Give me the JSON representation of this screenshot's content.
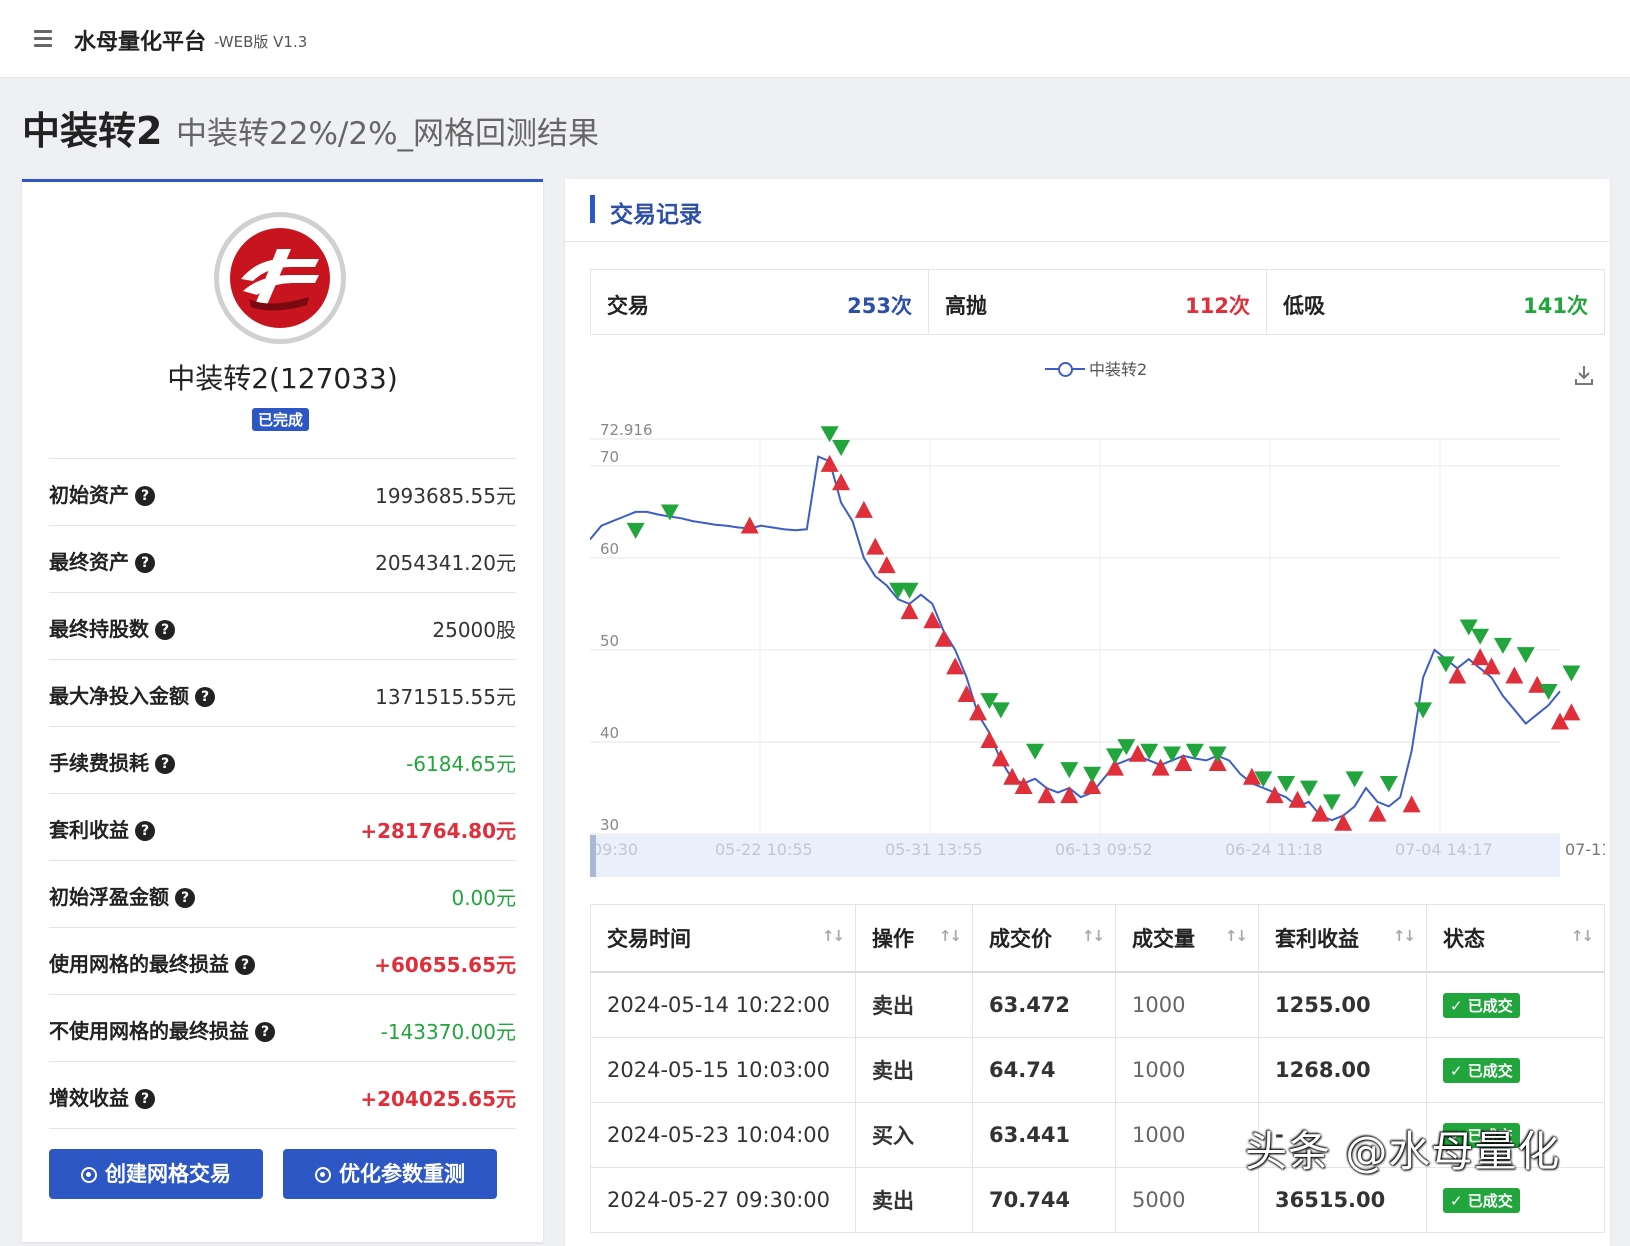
{
  "app": {
    "title": "水母量化平台",
    "subtitle": "-WEB版 V1.3"
  },
  "page": {
    "title": "中装转2",
    "subtitle": "中装转22%/2%_网格回测结果"
  },
  "summary_card": {
    "stock_name": "中装转2(127033)",
    "status_badge": "已完成",
    "stats": [
      {
        "label": "初始资产",
        "value": "1993685.55元",
        "tone": "normal"
      },
      {
        "label": "最终资产",
        "value": "2054341.20元",
        "tone": "normal"
      },
      {
        "label": "最终持股数",
        "value": "25000股",
        "tone": "normal"
      },
      {
        "label": "最大净投入金额",
        "value": "1371515.55元",
        "tone": "normal"
      },
      {
        "label": "手续费损耗",
        "value": "-6184.65元",
        "tone": "green"
      },
      {
        "label": "套利收益",
        "value": "+281764.80元",
        "tone": "red"
      },
      {
        "label": "初始浮盈金额",
        "value": "0.00元",
        "tone": "green"
      },
      {
        "label": "使用网格的最终损益",
        "value": "+60655.65元",
        "tone": "red"
      },
      {
        "label": "不使用网格的最终损益",
        "value": "-143370.00元",
        "tone": "green"
      },
      {
        "label": "增效收益",
        "value": "+204025.65元",
        "tone": "red"
      }
    ],
    "buttons": {
      "create": "创建网格交易",
      "optimize": "优化参数重测"
    }
  },
  "trade_panel": {
    "title": "交易记录",
    "summary": [
      {
        "label": "交易",
        "value": "253次",
        "color": "#2d4fa8"
      },
      {
        "label": "高抛",
        "value": "112次",
        "color": "#de2f3a"
      },
      {
        "label": "低吸",
        "value": "141次",
        "color": "#22a53c"
      }
    ],
    "table": {
      "headers": [
        "交易时间",
        "操作",
        "成交价",
        "成交量",
        "套利收益",
        "状态"
      ],
      "rows": [
        {
          "time": "2024-05-14 10:22:00",
          "op": "卖出",
          "op_type": "sell",
          "price": "63.472",
          "qty": "1000",
          "profit": "1255.00",
          "status": "已成交"
        },
        {
          "time": "2024-05-15 10:03:00",
          "op": "卖出",
          "op_type": "sell",
          "price": "64.74",
          "qty": "1000",
          "profit": "1268.00",
          "status": "已成交"
        },
        {
          "time": "2024-05-23 10:04:00",
          "op": "买入",
          "op_type": "buy",
          "price": "63.441",
          "qty": "1000",
          "profit": "-",
          "status": "已成交"
        },
        {
          "time": "2024-05-27 09:30:00",
          "op": "卖出",
          "op_type": "sell",
          "price": "70.744",
          "qty": "5000",
          "profit": "36515.00",
          "status": "已成交"
        }
      ]
    }
  },
  "chart_data": {
    "type": "line",
    "legend": [
      "中装转2"
    ],
    "series": [
      {
        "name": "中装转2",
        "color": "#3d5ec8",
        "values": [
          62,
          63.5,
          64,
          64.5,
          65,
          65,
          64.7,
          64.5,
          64.3,
          64,
          63.8,
          63.6,
          63.5,
          63.3,
          63.2,
          63.5,
          63.3,
          63.1,
          63,
          63.1,
          71,
          70.5,
          66,
          64,
          60,
          58,
          57,
          55.5,
          55,
          56,
          55,
          52,
          50,
          47,
          43,
          41,
          38,
          36,
          35.5,
          36,
          35,
          34.5,
          35,
          34,
          34.5,
          36,
          37.5,
          38,
          38.5,
          38,
          37.5,
          38,
          38.5,
          38.2,
          38,
          38.5,
          38,
          36.5,
          35.5,
          35,
          34.5,
          34,
          33,
          33.5,
          32,
          31.5,
          32,
          33,
          35,
          33.5,
          33,
          34,
          39,
          47,
          50,
          49,
          48,
          49,
          48,
          47,
          45,
          43.5,
          42,
          43,
          44,
          45.5
        ]
      }
    ],
    "y_ticks": [
      "30",
      "40",
      "50",
      "60",
      "70"
    ],
    "y_max_label": "72.916",
    "ylim": [
      30,
      72.916
    ],
    "x_ticks": [
      "09:30",
      "05-22 10:55",
      "05-31 13:55",
      "06-13 09:52",
      "06-24 11:18",
      "07-04 14:17",
      "07-11"
    ],
    "markers": {
      "sell_color": "#22a53c",
      "buy_color": "#de2f3a"
    },
    "sell_points": [
      [
        4,
        62.5
      ],
      [
        7,
        64.5
      ],
      [
        21,
        73
      ],
      [
        22,
        71.5
      ],
      [
        27,
        56
      ],
      [
        28,
        56
      ],
      [
        35,
        44
      ],
      [
        36,
        43
      ],
      [
        39,
        38.5
      ],
      [
        42,
        36.5
      ],
      [
        44,
        36
      ],
      [
        46,
        38
      ],
      [
        47,
        39
      ],
      [
        49,
        38.5
      ],
      [
        51,
        38.2
      ],
      [
        53,
        38.5
      ],
      [
        55,
        38.2
      ],
      [
        59,
        35.5
      ],
      [
        61,
        35
      ],
      [
        63,
        34.5
      ],
      [
        65,
        33
      ],
      [
        67,
        35.5
      ],
      [
        70,
        35
      ],
      [
        73,
        43
      ],
      [
        75,
        48
      ],
      [
        77,
        52
      ],
      [
        78,
        51
      ],
      [
        80,
        50
      ],
      [
        82,
        49
      ],
      [
        84,
        45
      ],
      [
        86,
        47
      ]
    ],
    "buy_points": [
      [
        14,
        63.3
      ],
      [
        21,
        70
      ],
      [
        22,
        68
      ],
      [
        24,
        65
      ],
      [
        25,
        61
      ],
      [
        26,
        59
      ],
      [
        28,
        54
      ],
      [
        30,
        53
      ],
      [
        31,
        51
      ],
      [
        32,
        48
      ],
      [
        33,
        45
      ],
      [
        34,
        43
      ],
      [
        35,
        40
      ],
      [
        36,
        38
      ],
      [
        37,
        36
      ],
      [
        38,
        35
      ],
      [
        40,
        34
      ],
      [
        42,
        34
      ],
      [
        44,
        35
      ],
      [
        46,
        37
      ],
      [
        48,
        38.5
      ],
      [
        50,
        37
      ],
      [
        52,
        37.5
      ],
      [
        55,
        37.5
      ],
      [
        58,
        36
      ],
      [
        60,
        34
      ],
      [
        62,
        33.5
      ],
      [
        64,
        32
      ],
      [
        66,
        31
      ],
      [
        69,
        32
      ],
      [
        72,
        33
      ],
      [
        76,
        47
      ],
      [
        78,
        49
      ],
      [
        79,
        48
      ],
      [
        81,
        47
      ],
      [
        83,
        46
      ],
      [
        85,
        42
      ],
      [
        86,
        43
      ]
    ]
  },
  "watermark": "头条 @水母量化"
}
